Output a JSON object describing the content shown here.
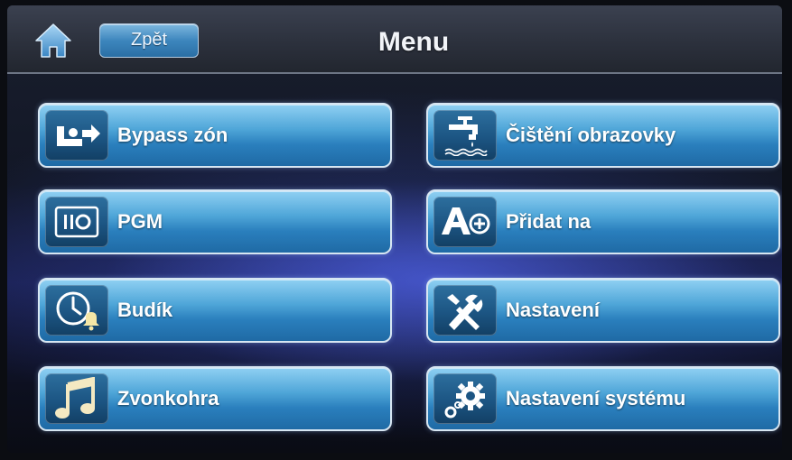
{
  "header": {
    "title": "Menu",
    "back_label": "Zpět",
    "home_icon": "home-icon"
  },
  "menu": {
    "items": [
      {
        "label": "Bypass zón",
        "icon": "bypass-zone-icon"
      },
      {
        "label": "Čištění obrazovky",
        "icon": "screen-cleaning-icon"
      },
      {
        "label": "PGM",
        "icon": "pgm-icon"
      },
      {
        "label": "Přidat na",
        "icon": "add-to-icon"
      },
      {
        "label": "Budík",
        "icon": "alarm-clock-icon"
      },
      {
        "label": "Nastavení",
        "icon": "tools-icon"
      },
      {
        "label": "Zvonkohra",
        "icon": "music-note-icon"
      },
      {
        "label": "Nastavení systému",
        "icon": "system-settings-icon"
      }
    ]
  },
  "colors": {
    "tile_accent": "#4fa6d8",
    "tile_border": "#d7e6f2",
    "header_bg": "#2c313d"
  }
}
